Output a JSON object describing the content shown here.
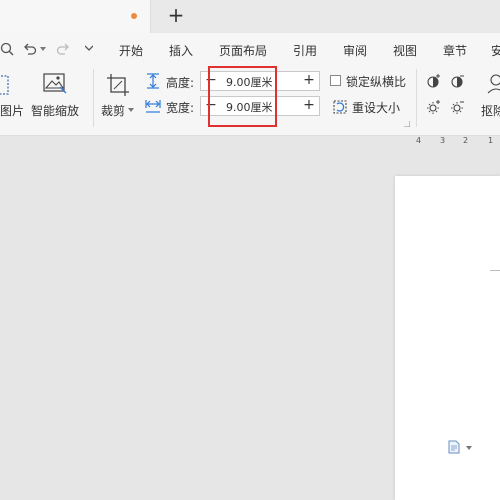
{
  "tab_bar": {
    "new_tab_icon": "plus-icon"
  },
  "quick_access": [
    "zoom-icon",
    "undo-icon",
    "dropdown-icon",
    "redo-icon",
    "customize-dropdown-icon"
  ],
  "menu": [
    "开始",
    "插入",
    "页面布局",
    "引用",
    "审阅",
    "视图",
    "章节",
    "安"
  ],
  "ribbon": {
    "picture_label": "图片",
    "smart_zoom_label": "智能缩放",
    "crop_label": "裁剪",
    "height_label": "高度:",
    "width_label": "宽度:",
    "height_value": "9.00厘米",
    "width_value": "9.00厘米",
    "stepper_minus": "−",
    "stepper_plus": "+",
    "lock_ratio_label": "锁定纵横比",
    "reset_size_label": "重设大小",
    "cutout_label": "抠除"
  },
  "ruler_numbers": [
    "4",
    "3",
    "2",
    "1"
  ],
  "colors": {
    "highlight": "#e03131",
    "unsaved_dot": "#f08a3a"
  }
}
